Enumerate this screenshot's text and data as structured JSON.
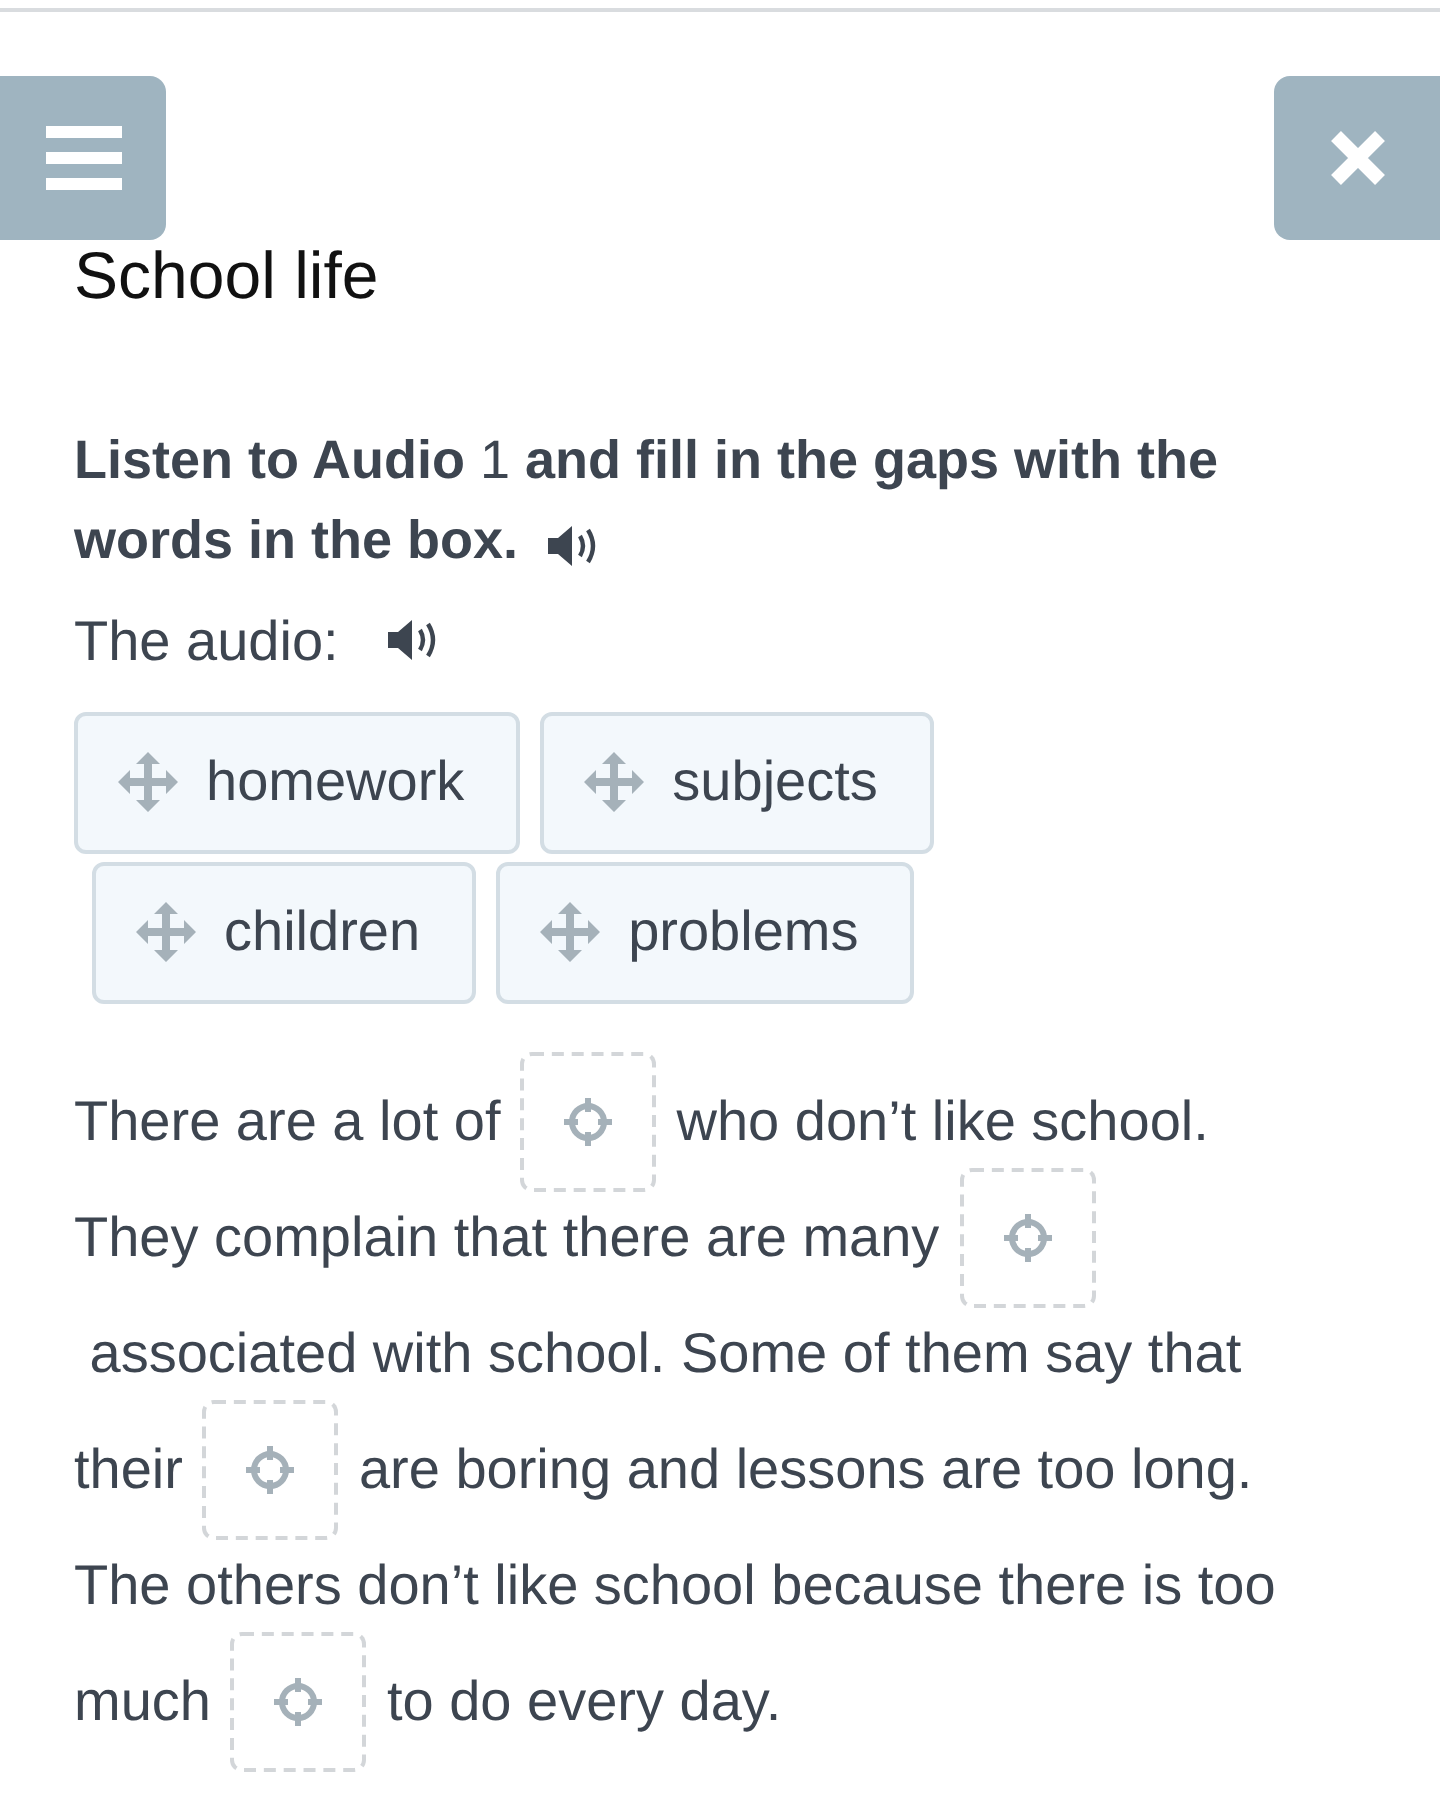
{
  "title": "School life",
  "instruction_lines": [
    {
      "text": "**Listen to Audio** 1 **and fill in the gaps with the**"
    },
    {
      "text": "**words in the box.**"
    }
  ],
  "audio_label": "The audio:",
  "words": [
    {
      "text": "homework"
    },
    {
      "text": "subjects"
    },
    {
      "text": "children"
    },
    {
      "text": "problems"
    }
  ],
  "passage_lines": [
    [
      {
        "kind": "text",
        "text": "There are a lot of"
      },
      {
        "kind": "gap"
      },
      {
        "kind": "text",
        "text": "who don’t like school."
      }
    ],
    [
      {
        "kind": "text",
        "text": "They complain that there are many"
      },
      {
        "kind": "gap"
      }
    ],
    [
      {
        "kind": "text",
        "text": " associated with school. Some of them say that"
      }
    ],
    [
      {
        "kind": "text",
        "text": "their"
      },
      {
        "kind": "gap"
      },
      {
        "kind": "text",
        "text": "are boring and lessons are too long."
      }
    ],
    [
      {
        "kind": "text",
        "text": "The others don’t like school because there is too"
      }
    ],
    [
      {
        "kind": "text",
        "text": "much"
      },
      {
        "kind": "gap"
      },
      {
        "kind": "text",
        "text": "to do every day."
      }
    ]
  ]
}
